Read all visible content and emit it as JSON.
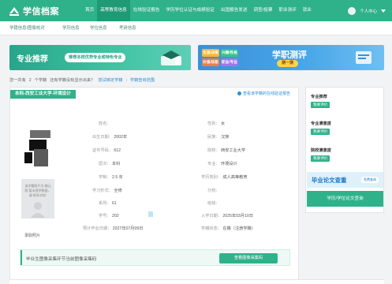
{
  "brand": {
    "name": "学信档案",
    "color": "#2fb289"
  },
  "nav": {
    "items": [
      "首页",
      "高等教育信息",
      "在线验证报告",
      "学历学位认证与成绩验证",
      "出国报告发送",
      "调查/投票",
      "职业测评",
      "就业"
    ],
    "active_index": 1
  },
  "user": {
    "label": "个人中心"
  },
  "subnav": {
    "items": [
      "学籍信息/图像校对",
      "学历信息",
      "学位信息",
      "考研信息"
    ]
  },
  "banners": {
    "left": {
      "title": "专业推荐",
      "subtitle": "推荐本校优势专业或特色专业"
    },
    "right": {
      "tags": [
        "生涯/决策",
        "兴趣/性格",
        "价值/技能",
        "职业/专业"
      ],
      "title": "学职测评",
      "pill": "测一测"
    }
  },
  "info_line": {
    "found_text": "您一共有",
    "count": "2",
    "unit": "个学籍",
    "question": "还有学籍没有显示出来？",
    "bind_link": "尝试绑定学籍",
    "report_link": "学籍查询范围"
  },
  "record": {
    "title": "本科-西安工业大学-环境设计",
    "head_link": "查看该学籍的在线验证报告",
    "photo_note": "该学籍照片为“确认版”暂未提供数据，请“联系学校”",
    "photo_caption": "录取照片",
    "fields_left": [
      {
        "label": "姓名：",
        "value": ""
      },
      {
        "label": "出生日期：",
        "value": "2002年"
      },
      {
        "label": "证件号码：",
        "value": "612"
      },
      {
        "label": "层次：",
        "value": "本科"
      },
      {
        "label": "学制：",
        "value": "2.5 年"
      },
      {
        "label": "学习形式：",
        "value": "全修"
      },
      {
        "label": "系所：",
        "value": "61"
      },
      {
        "label": "学号：",
        "value": "202"
      },
      {
        "label": "预计毕业日期：",
        "value": "2027年07月09日"
      }
    ],
    "fields_right": [
      {
        "label": "性别：",
        "value": "女"
      },
      {
        "label": "民族：",
        "value": "汉族"
      },
      {
        "label": "院校：",
        "value": "西安工业大学"
      },
      {
        "label": "专业：",
        "value": "环境设计"
      },
      {
        "label": "学历类别：",
        "value": "成人高等教育"
      },
      {
        "label": "分校：",
        "value": ""
      },
      {
        "label": "班级：",
        "value": ""
      },
      {
        "label": "入学日期：",
        "value": "2025年03月10日"
      },
      {
        "label": "学籍状态：",
        "value": "在籍（注册学籍）"
      }
    ],
    "notice_text": "毕业生图像采集环节当前图像采集码",
    "notice_button": "查看图像采集码"
  },
  "side": {
    "sections": [
      {
        "title": "专业推荐",
        "button": "我要评价"
      },
      {
        "title": "专业满意度",
        "button": "我要评价"
      },
      {
        "title": "院校满意度",
        "button": "我要评价"
      }
    ],
    "paper_ad": {
      "title": "毕业论文查重",
      "pill": "免费查询"
    },
    "paper_button": "学历/学位论文查询"
  }
}
